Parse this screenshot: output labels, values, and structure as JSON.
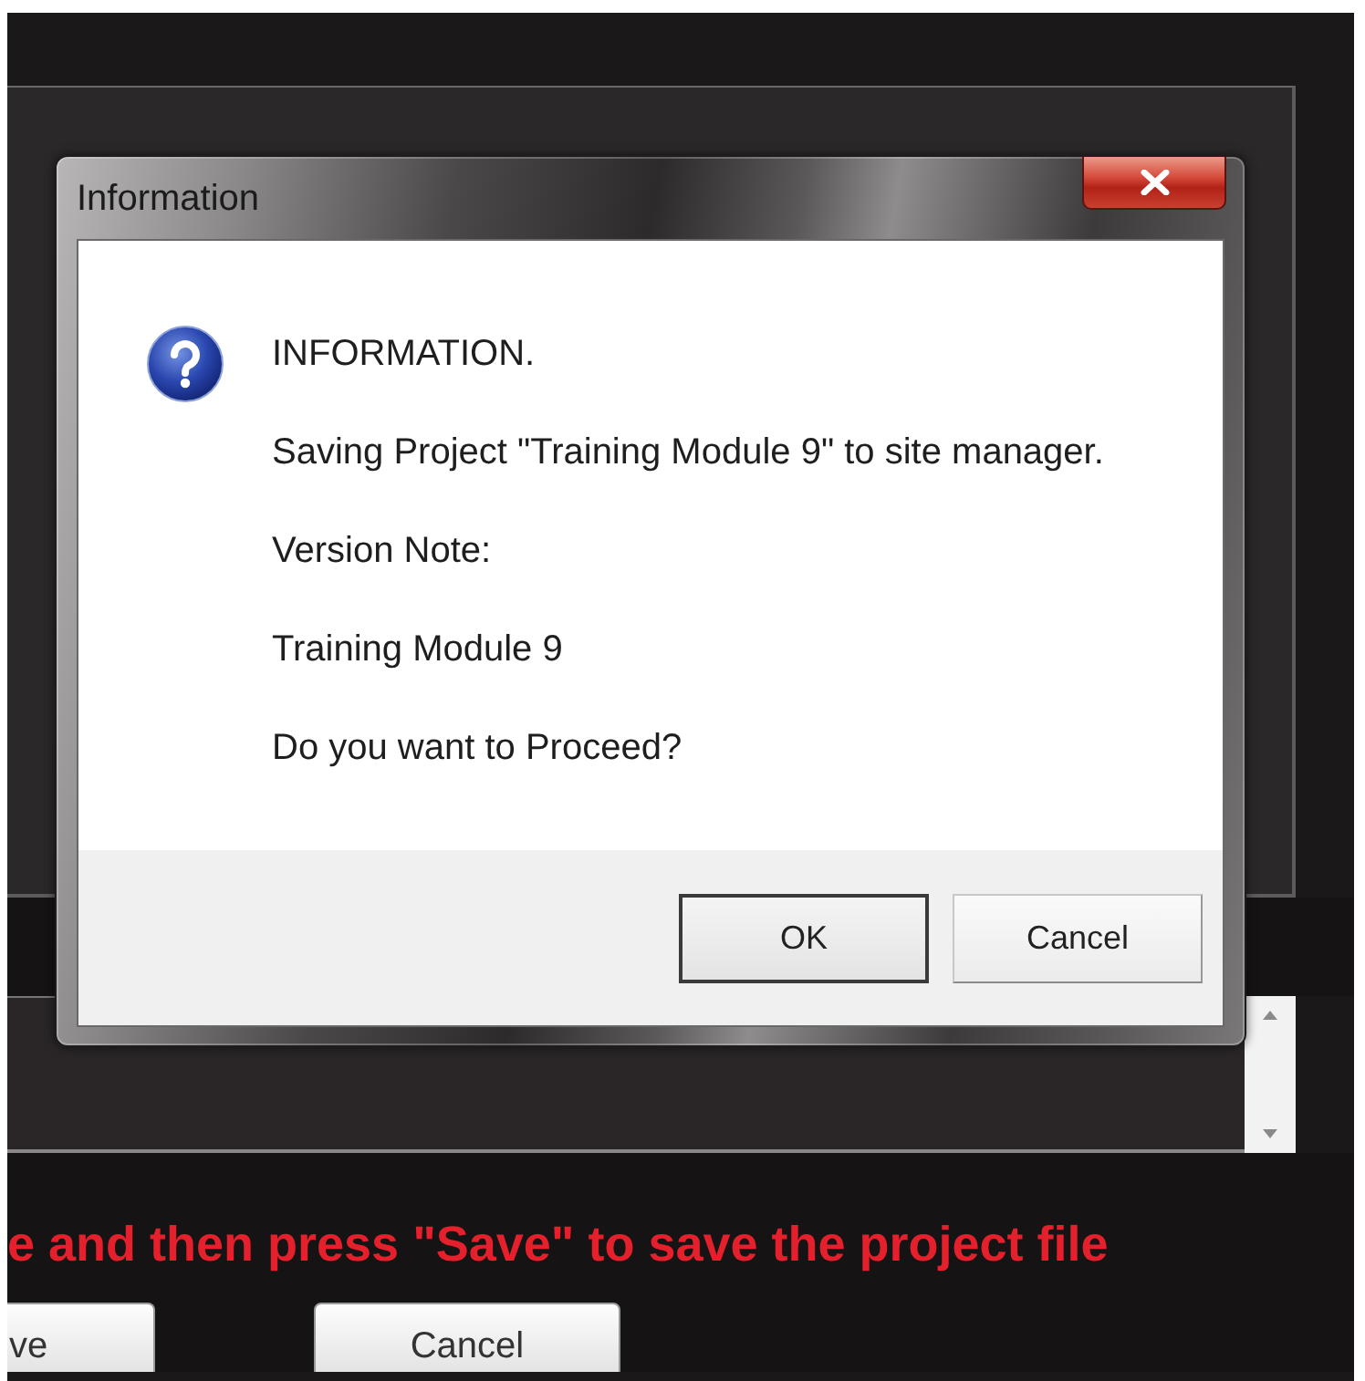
{
  "background_window": {
    "instruction": "e and then press \"Save\" to save the project file",
    "buttons": [
      {
        "label": "ve"
      },
      {
        "label": "Cancel"
      }
    ]
  },
  "dialog": {
    "title": "Information",
    "lines": [
      "INFORMATION.",
      "Saving Project \"Training Module 9\" to site manager.",
      "Version Note:",
      "Training Module 9",
      "Do you want to Proceed?"
    ],
    "buttons": [
      {
        "label": "OK",
        "default": true
      },
      {
        "label": "Cancel",
        "default": false
      }
    ]
  }
}
